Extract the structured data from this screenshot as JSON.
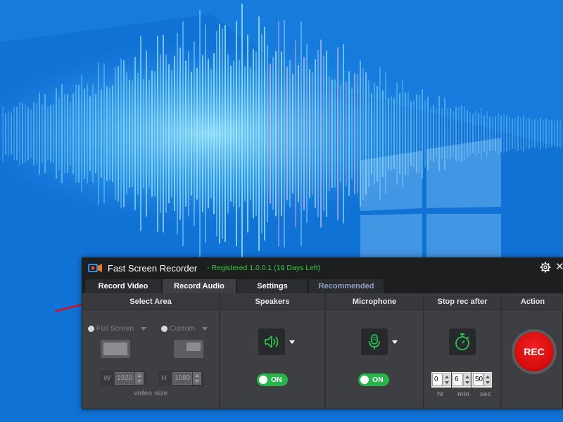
{
  "app": {
    "title": "Fast Screen Recorder",
    "registration_status": "- Registered 1.0.0.1 (19 Days Left)",
    "status_color": "#35c93a"
  },
  "window_controls": {
    "settings_icon": "gear-icon",
    "close_glyph": "✕"
  },
  "tabs": [
    {
      "label": "Record Video",
      "active": false
    },
    {
      "label": "Record Audio",
      "active": true
    },
    {
      "label": "Settings",
      "active": false
    },
    {
      "label": "Recommended",
      "active": false
    }
  ],
  "select_area": {
    "header": "Select Area",
    "full_screen_label": "Full Screen",
    "custom_label": "Custom",
    "width_label": "W",
    "width_value": "1920",
    "height_label": "H",
    "height_value": "1080",
    "video_size_label": "video size"
  },
  "speakers": {
    "header": "Speakers",
    "icon": "speaker-icon",
    "toggle_label": "ON",
    "enabled": true
  },
  "microphone": {
    "header": "Microphone",
    "icon": "microphone-icon",
    "toggle_label": "ON",
    "enabled": true
  },
  "stop_rec_after": {
    "header": "Stop rec after",
    "icon": "stopwatch-icon",
    "hours": "0",
    "minutes": "6",
    "seconds": "50",
    "hr_label": "hr",
    "min_label": "min",
    "sec_label": "sec"
  },
  "action": {
    "header": "Action",
    "rec_label": "REC",
    "rec_color": "#e01010"
  },
  "accent_color": "#29b34a"
}
